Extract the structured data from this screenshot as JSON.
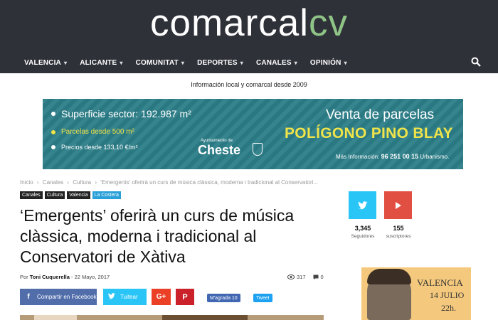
{
  "header": {
    "logo_part1": "comarcal",
    "logo_part2": "cv",
    "nav": [
      {
        "label": "VALENCIA"
      },
      {
        "label": "ALICANTE"
      },
      {
        "label": "COMUNITAT"
      },
      {
        "label": "DEPORTES"
      },
      {
        "label": "CANALES"
      },
      {
        "label": "OPINIÓN"
      }
    ],
    "tagline": "Información local y comarcal desde 2009"
  },
  "banner": {
    "line1": "Superficie sector: 192.987 m²",
    "line2": "Parcelas desde 500 m²",
    "line3": "Precios desde 133,10 €/m²",
    "ayuntamiento": "Ayuntamiento de",
    "town": "Cheste",
    "headline1": "Venta de parcelas",
    "headline2": "POLÍGONO PINO BLAY",
    "info_label": "Más Información:",
    "info_phone": "96 251 00 15",
    "info_suffix": "Urbanismo."
  },
  "breadcrumb": {
    "items": [
      "Inicio",
      "›",
      "Canales",
      "›",
      "Cultura",
      "›",
      "'Emergents' oferirà un curs de música clàssica, moderna i tradicional al Conservatori..."
    ]
  },
  "categories": [
    "Canales",
    "Cultura",
    "Valencia",
    "La Costera"
  ],
  "article": {
    "title": "‘Emergents’ oferirà un curs de música clàssica, moderna i tradicional al Conservatori de Xàtiva",
    "by": "Por",
    "author": "Toni Cuquerella",
    "dash": "-",
    "date": "22 Mayo, 2017",
    "views": "317",
    "comments": "0"
  },
  "share": {
    "facebook": "Compartir en Facebook",
    "twitter": "Tuitear",
    "gplus": "G+",
    "pinterest": "P",
    "fb_like": "M'agrada 10",
    "tweet": "Tweet"
  },
  "sidebar": {
    "twitter_count": "3,345",
    "twitter_label": "Seguidores",
    "youtube_count": "155",
    "youtube_label": "suscriptores",
    "ad_city": "VALENCIA",
    "ad_date": "14 JULIO",
    "ad_time": "22h."
  },
  "colors": {
    "header_bg": "#2f3139",
    "logo_accent": "#8fc487",
    "banner_bg": "#2a7c86",
    "banner_yellow": "#f0e44a",
    "facebook": "#516eab",
    "twitter": "#29c5f6",
    "youtube": "#e14e42"
  }
}
